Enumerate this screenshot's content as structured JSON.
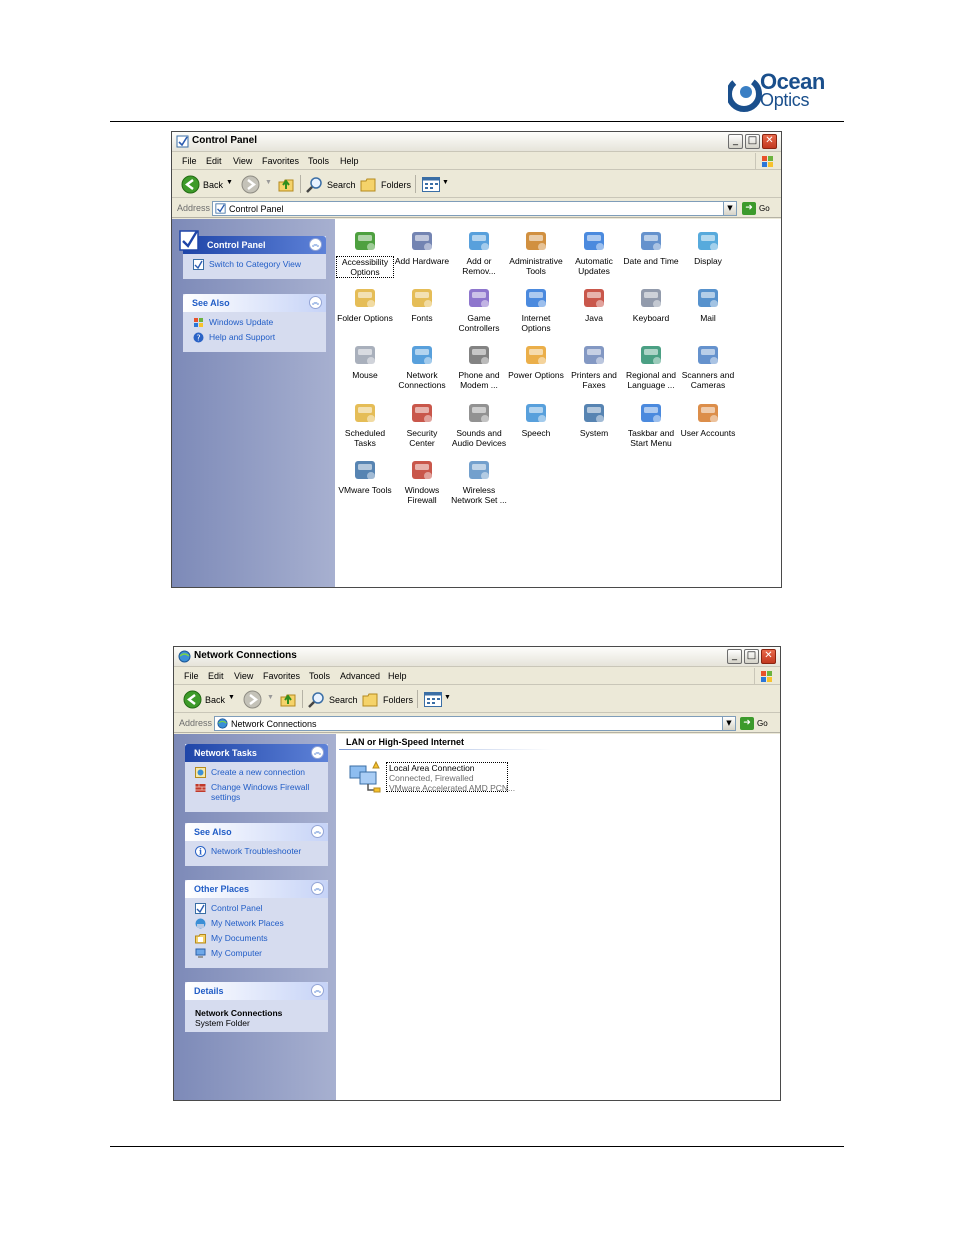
{
  "logo": {
    "text1": "Ocean",
    "text2": "Optics"
  },
  "control_panel": {
    "title": "Control Panel",
    "menu": [
      "File",
      "Edit",
      "View",
      "Favorites",
      "Tools",
      "Help"
    ],
    "toolbar": {
      "back": "Back",
      "search": "Search",
      "folders": "Folders"
    },
    "address_label": "Address",
    "address_value": "Control Panel",
    "go_label": "Go",
    "tasks": {
      "title": "Control Panel",
      "links": [
        "Switch to Category View"
      ]
    },
    "see_also": {
      "title": "See Also",
      "links": [
        "Windows Update",
        "Help and Support"
      ]
    },
    "items": [
      {
        "label": "Accessibility Options",
        "icon": "accessibility-icon"
      },
      {
        "label": "Add Hardware",
        "icon": "hardware-icon"
      },
      {
        "label": "Add or Remov...",
        "icon": "add-remove-icon"
      },
      {
        "label": "Administrative Tools",
        "icon": "admin-tools-icon"
      },
      {
        "label": "Automatic Updates",
        "icon": "windows-update-icon"
      },
      {
        "label": "Date and Time",
        "icon": "clock-icon"
      },
      {
        "label": "Display",
        "icon": "display-icon"
      },
      {
        "label": "Folder Options",
        "icon": "folder-options-icon"
      },
      {
        "label": "Fonts",
        "icon": "fonts-folder-icon"
      },
      {
        "label": "Game Controllers",
        "icon": "gamepad-icon"
      },
      {
        "label": "Internet Options",
        "icon": "globe-icon"
      },
      {
        "label": "Java",
        "icon": "java-icon"
      },
      {
        "label": "Keyboard",
        "icon": "keyboard-icon"
      },
      {
        "label": "Mail",
        "icon": "mail-icon"
      },
      {
        "label": "Mouse",
        "icon": "mouse-icon"
      },
      {
        "label": "Network Connections",
        "icon": "network-icon"
      },
      {
        "label": "Phone and Modem ...",
        "icon": "phone-icon"
      },
      {
        "label": "Power Options",
        "icon": "power-icon"
      },
      {
        "label": "Printers and Faxes",
        "icon": "printer-icon"
      },
      {
        "label": "Regional and Language ...",
        "icon": "regional-globe-icon"
      },
      {
        "label": "Scanners and Cameras",
        "icon": "scanner-icon"
      },
      {
        "label": "Scheduled Tasks",
        "icon": "scheduled-tasks-icon"
      },
      {
        "label": "Security Center",
        "icon": "shield-icon"
      },
      {
        "label": "Sounds and Audio Devices",
        "icon": "speaker-icon"
      },
      {
        "label": "Speech",
        "icon": "speech-icon"
      },
      {
        "label": "System",
        "icon": "system-icon"
      },
      {
        "label": "Taskbar and Start Menu",
        "icon": "taskbar-icon"
      },
      {
        "label": "User Accounts",
        "icon": "users-icon"
      },
      {
        "label": "VMware Tools",
        "icon": "vmware-icon"
      },
      {
        "label": "Windows Firewall",
        "icon": "firewall-icon"
      },
      {
        "label": "Wireless Network Set ...",
        "icon": "wireless-icon"
      }
    ]
  },
  "network_connections": {
    "title": "Network Connections",
    "menu": [
      "File",
      "Edit",
      "View",
      "Favorites",
      "Tools",
      "Advanced",
      "Help"
    ],
    "toolbar": {
      "back": "Back",
      "search": "Search",
      "folders": "Folders"
    },
    "address_label": "Address",
    "address_value": "Network Connections",
    "go_label": "Go",
    "network_tasks": {
      "title": "Network Tasks",
      "links": [
        "Create a new connection",
        "Change Windows Firewall settings"
      ]
    },
    "see_also": {
      "title": "See Also",
      "links": [
        "Network Troubleshooter"
      ]
    },
    "other_places": {
      "title": "Other Places",
      "links": [
        "Control Panel",
        "My Network Places",
        "My Documents",
        "My Computer"
      ]
    },
    "details": {
      "title": "Details",
      "name": "Network Connections",
      "type": "System Folder"
    },
    "section": "LAN or High-Speed Internet",
    "connection": {
      "name": "Local Area Connection",
      "status": "Connected, Firewalled",
      "device": "VMware Accelerated AMD PCN..."
    }
  }
}
